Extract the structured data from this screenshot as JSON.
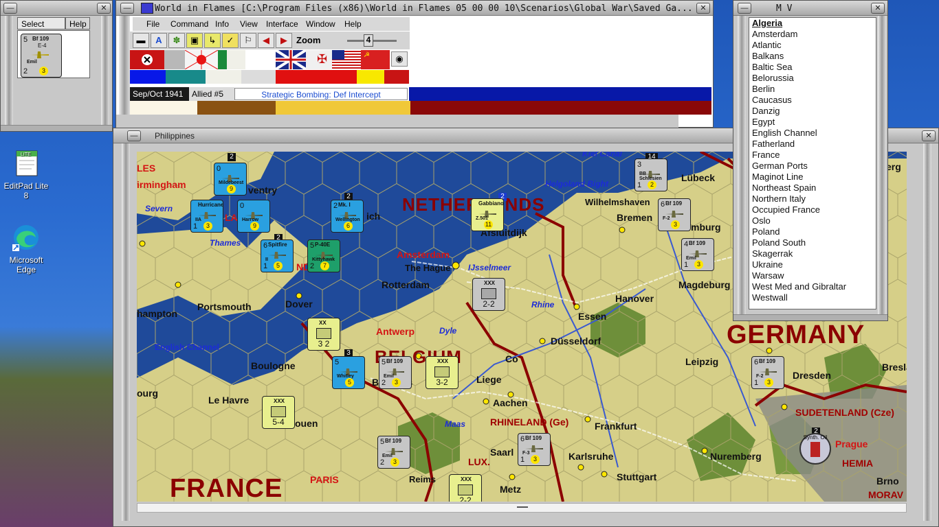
{
  "desktop": {
    "icons": [
      {
        "label": "EditPad Lite 8"
      },
      {
        "label": "Microsoft Edge"
      }
    ]
  },
  "select_window": {
    "tabs": [
      "Select",
      "Help"
    ],
    "unit": {
      "strength": "5",
      "name": "Bf 109",
      "model": "E-4",
      "sub": "Emil",
      "range": "2",
      "move": "3"
    }
  },
  "main_window": {
    "title": "World in Flames [C:\\Program Files (x86)\\World in Flames 05 00 00 10\\Scenarios\\Global War\\Saved Ga...",
    "menu": [
      "File",
      "Command",
      "Info",
      "View",
      "Interface",
      "Window",
      "Help"
    ],
    "zoom_label": "Zoom",
    "zoom_value": "4",
    "date": "Sep/Oct 1941",
    "impulse": "Allied #5",
    "phase": "Strategic Bombing: Def Intercept",
    "colors": {
      "axis": "#1a1a1a",
      "allied": "#0b1fd0"
    }
  },
  "mv_window": {
    "title": "M V",
    "items": [
      "Algeria",
      "Amsterdam",
      "Atlantic",
      "Balkans",
      "Baltic Sea",
      "Belorussia",
      "Berlin",
      "Caucasus",
      "Danzig",
      "Egypt",
      "English Channel",
      "Fatherland",
      "France",
      "German Ports",
      "Maginot Line",
      "Northeast Spain",
      "Northern Italy",
      "Occupied France",
      "Oslo",
      "Poland",
      "Poland South",
      "Skagerrak",
      "Ukraine",
      "Warsaw",
      "West Med and Gibraltar",
      "Westwall"
    ],
    "selected": "Algeria"
  },
  "map_window": {
    "title": "Philippines",
    "labels": {
      "netherlands": "NETHERLANDS",
      "belgium": "BELGIUM",
      "germany": "GERMANY",
      "france": "FRANCE",
      "lux": "LUX.",
      "rhineland": "RHINELAND (Ge)",
      "sudetenland": "SUDETENLAND (Cze)",
      "bohemia": "HEMIA",
      "morava": "MORAV",
      "kiel_canal": "Kiel Canal",
      "helgoland": "Helgoland Bight",
      "english_channel": "English Channel",
      "severn": "Severn",
      "thames": "Thames",
      "ijsselmeer": "IJsselmeer",
      "rhine": "Rhine",
      "dyle": "Dyle",
      "maas": "Maas",
      "amsterdam": "Amsterdam",
      "antwerp": "Antwerp",
      "paris": "PARIS",
      "prague": "Prague",
      "les": "LES",
      "ngland": "ND",
      "la": "LA",
      "birmingham": "irmingham",
      "coventry": "ventry",
      "harwich": "ich",
      "portsmouth": "Portsmouth",
      "southampton": "hampton",
      "dover": "Dover",
      "boulogne": "Boulogne",
      "cherbourg": "ourg",
      "lehavre": "Le Havre",
      "rouen": "ouen",
      "reims": "Reims",
      "metz": "Metz",
      "hague": "The Hague",
      "rotterdam": "Rotterdam",
      "afsluitdijk": "Afsluitdijk",
      "brussels": "Brussels",
      "liege": "Liege",
      "aachen": "Aachen",
      "essen": "Essen",
      "dusseldorf": "Düsseldorf",
      "hanover": "Hanover",
      "magdeburg": "Magdeburg",
      "leipzig": "Leipzig",
      "dresden": "Dresden",
      "breslau": "Breslau",
      "frankfurt": "Frankfurt",
      "karlsruhe": "Karlsruhe",
      "stuttgart": "Stuttgart",
      "nuremberg": "Nuremberg",
      "saarbrucken": "Saarl",
      "bremen": "Bremen",
      "wilhelmshaven": "Wilhelmshaven",
      "lubeck": "Lübeck",
      "hamburg": "mburg",
      "berg": "erg",
      "brno": "Brno",
      "co": "Co"
    },
    "stacks": [
      "2",
      "2",
      "2",
      "14",
      "2",
      "3",
      "2"
    ],
    "units": [
      {
        "id": "u1",
        "strength": "0",
        "name": "",
        "sub": "Mildebeest",
        "range": "",
        "move": "9",
        "style": "c-uk"
      },
      {
        "id": "u2",
        "strength": "",
        "name": "Hurricane",
        "sub": "IIA",
        "range": "1",
        "move": "3",
        "style": "c-uk"
      },
      {
        "id": "u3",
        "strength": "0",
        "name": "",
        "sub": "Harrow",
        "range": "",
        "move": "9",
        "style": "c-uk"
      },
      {
        "id": "u4",
        "strength": "6",
        "name": "Spitfire",
        "sub": "II",
        "range": "1",
        "move": "5",
        "style": "c-uk"
      },
      {
        "id": "u5",
        "strength": "5",
        "name": "P-40E",
        "sub": "Kittyhawk",
        "range": "2",
        "move": "7",
        "style": "c-us"
      },
      {
        "id": "u6",
        "strength": "2",
        "name": "Mk. I",
        "sub": "Wellington",
        "range": "",
        "move": "6",
        "style": "c-uk"
      },
      {
        "id": "u7",
        "strength": "",
        "name": "Gabbiano",
        "sub": "Z.501",
        "range": "",
        "move": "11",
        "style": "c-yl"
      },
      {
        "id": "u8",
        "strength": "3",
        "name": "",
        "sub": "BB Schlesien",
        "range": "1",
        "move": "2",
        "style": "c-de"
      },
      {
        "id": "u9",
        "strength": "6",
        "name": "Bf 109",
        "sub": "F-2",
        "range": "",
        "move": "3",
        "style": "c-de"
      },
      {
        "id": "u10",
        "strength": "4",
        "name": "Bf 109",
        "sub": "Emil",
        "range": "1",
        "move": "3",
        "style": "c-de"
      },
      {
        "id": "u11",
        "strength": "5",
        "name": "Bf 109",
        "sub": "Emil",
        "range": "2",
        "move": "3",
        "style": "c-de"
      },
      {
        "id": "u12",
        "strength": "6",
        "name": "Bf 109",
        "sub": "F-2",
        "range": "1",
        "move": "3",
        "style": "c-de"
      },
      {
        "id": "u13",
        "strength": "5",
        "name": "Bf 109",
        "sub": "Emil",
        "range": "2",
        "move": "3",
        "style": "c-de"
      },
      {
        "id": "u14",
        "strength": "6",
        "name": "Bf 109",
        "sub": "F-3",
        "range": "1",
        "move": "3",
        "style": "c-de"
      },
      {
        "id": "u15",
        "strength": "5",
        "name": "",
        "sub": "Whitley",
        "range": "",
        "move": "5",
        "style": "c-uk"
      }
    ],
    "land_units": [
      {
        "id": "l1",
        "size": "XXX",
        "val": "2-2",
        "style": "c-de"
      },
      {
        "id": "l2",
        "size": "XX",
        "val": "3 2",
        "style": "c-yl"
      },
      {
        "id": "l3",
        "size": "XXX",
        "val": "3-2",
        "style": "c-yl"
      },
      {
        "id": "l4",
        "size": "XXX",
        "val": "5-4",
        "style": "c-yl"
      },
      {
        "id": "l5",
        "size": "XXX",
        "val": "2-2",
        "style": "c-yl"
      }
    ],
    "synth_oil": "Synth. Oil"
  }
}
